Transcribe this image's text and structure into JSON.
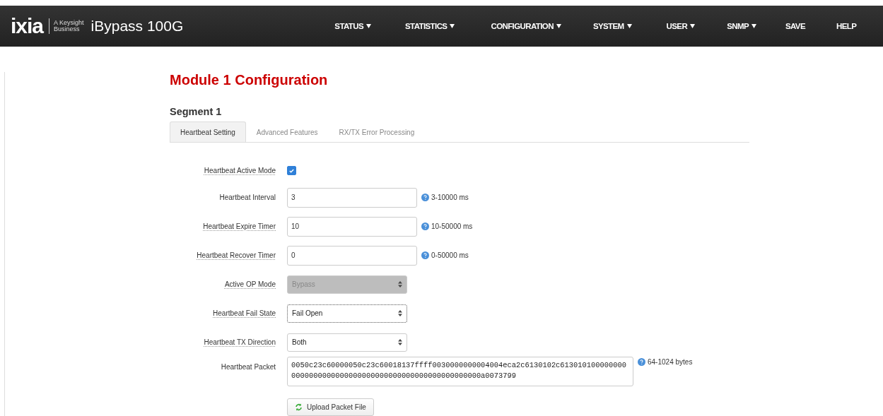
{
  "brand": {
    "logo": "ixia",
    "tagline_1": "A Keysight",
    "tagline_2": "Business",
    "product": "iBypass 100G"
  },
  "nav": [
    {
      "label": "STATUS",
      "dropdown": true
    },
    {
      "label": "STATISTICS",
      "dropdown": true
    },
    {
      "label": "CONFIGURATION",
      "dropdown": true
    },
    {
      "label": "SYSTEM",
      "dropdown": true
    },
    {
      "label": "USER",
      "dropdown": true
    },
    {
      "label": "SNMP",
      "dropdown": true
    },
    {
      "label": "SAVE",
      "dropdown": false
    },
    {
      "label": "HELP",
      "dropdown": false
    }
  ],
  "title": "Module 1 Configuration",
  "segment": "Segment 1",
  "tabs": [
    {
      "label": "Heartbeat Setting",
      "selected": true
    },
    {
      "label": "Advanced Features",
      "selected": false
    },
    {
      "label": "RX/TX Error Processing",
      "selected": false
    }
  ],
  "fields": [
    {
      "kind": "checkbox",
      "label": "Heartbeat Active Mode",
      "tooltip": true,
      "checked": true
    },
    {
      "kind": "text",
      "label": "Heartbeat Interval",
      "tooltip": false,
      "value": "3",
      "hint": "3-10000 ms"
    },
    {
      "kind": "text",
      "label": "Heartbeat Expire Timer",
      "tooltip": true,
      "value": "10",
      "hint": "10-50000 ms"
    },
    {
      "kind": "text",
      "label": "Heartbeat Recover Timer",
      "tooltip": true,
      "value": "0",
      "hint": "0-50000 ms"
    },
    {
      "kind": "select",
      "label": "Active OP Mode",
      "tooltip": true,
      "value": "Bypass",
      "disabled": true,
      "focused": false
    },
    {
      "kind": "select",
      "label": "Heartbeat Fail State",
      "tooltip": true,
      "value": "Fail Open",
      "disabled": false,
      "focused": true
    },
    {
      "kind": "select",
      "label": "Heartbeat TX Direction",
      "tooltip": true,
      "value": "Both",
      "disabled": false,
      "focused": false
    },
    {
      "kind": "textarea",
      "label": "Heartbeat Packet",
      "tooltip": false,
      "value": "0050c23c60000050c23c60018137ffff0030000000004004eca2c6130102c6130101000000000000000000000000000000000000000000000000000a0073799",
      "hint": "64-1024 bytes"
    }
  ],
  "upload_button": "Upload Packet File"
}
